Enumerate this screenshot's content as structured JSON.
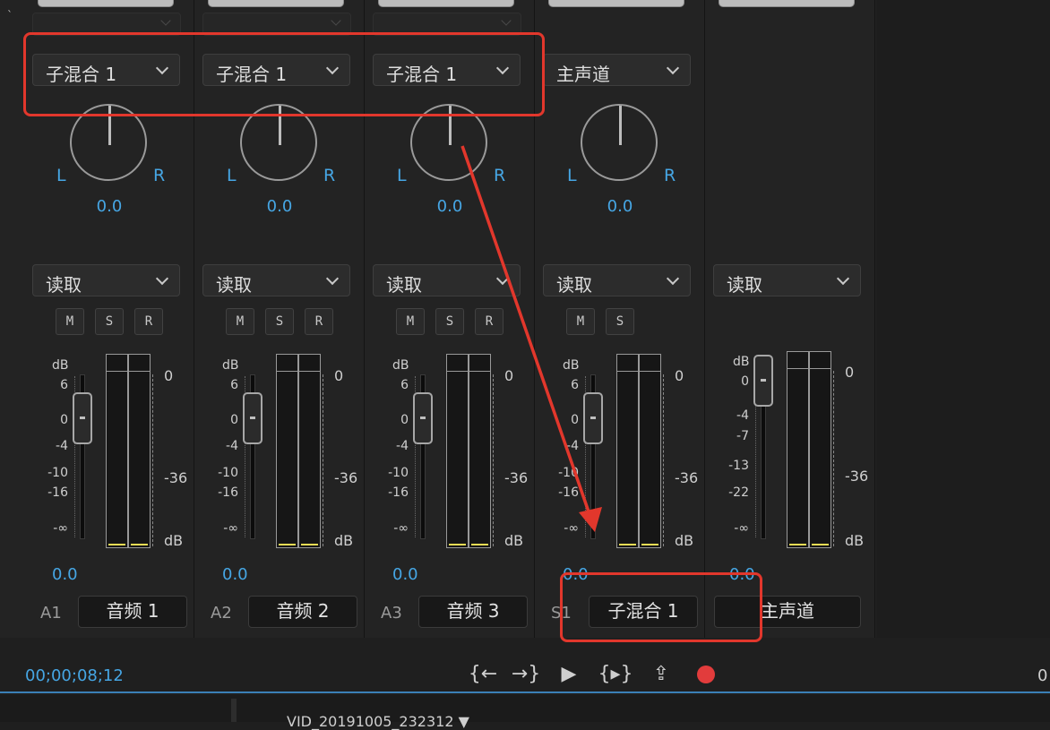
{
  "corner_mark": "`",
  "channels": [
    {
      "id": "A1",
      "output": "子混合 1",
      "pan_l": "L",
      "pan_r": "R",
      "pan_value": "0.0",
      "automation": "读取",
      "buttons": [
        "M",
        "S",
        "R"
      ],
      "scale_header": "dB",
      "scale": [
        "6",
        "0",
        "-4",
        "-10",
        "-16",
        "-∞"
      ],
      "meter_scale": [
        "0",
        "-36",
        "dB"
      ],
      "volume": "0.0",
      "name": "音频 1"
    },
    {
      "id": "A2",
      "output": "子混合 1",
      "pan_l": "L",
      "pan_r": "R",
      "pan_value": "0.0",
      "automation": "读取",
      "buttons": [
        "M",
        "S",
        "R"
      ],
      "scale_header": "dB",
      "scale": [
        "6",
        "0",
        "-4",
        "-10",
        "-16",
        "-∞"
      ],
      "meter_scale": [
        "0",
        "-36",
        "dB"
      ],
      "volume": "0.0",
      "name": "音频 2"
    },
    {
      "id": "A3",
      "output": "子混合 1",
      "pan_l": "L",
      "pan_r": "R",
      "pan_value": "0.0",
      "automation": "读取",
      "buttons": [
        "M",
        "S",
        "R"
      ],
      "scale_header": "dB",
      "scale": [
        "6",
        "0",
        "-4",
        "-10",
        "-16",
        "-∞"
      ],
      "meter_scale": [
        "0",
        "-36",
        "dB"
      ],
      "volume": "0.0",
      "name": "音频 3"
    },
    {
      "id": "S1",
      "output": "主声道",
      "pan_l": "L",
      "pan_r": "R",
      "pan_value": "0.0",
      "automation": "读取",
      "buttons": [
        "M",
        "S"
      ],
      "scale_header": "dB",
      "scale": [
        "6",
        "0",
        "-4",
        "-10",
        "-16",
        "-∞"
      ],
      "meter_scale": [
        "0",
        "-36",
        "dB"
      ],
      "volume": "0.0",
      "name": "子混合 1"
    }
  ],
  "master": {
    "automation": "读取",
    "scale_header": "dB",
    "scale": [
      "0",
      "-4",
      "-7",
      "-13",
      "-22",
      "-∞"
    ],
    "meter_scale": [
      "0",
      "-36",
      "dB"
    ],
    "volume": "0.0",
    "name": "主声道"
  },
  "transport": {
    "timecode": "00;00;08;12",
    "step_back": "{←",
    "step_forward": "→}",
    "play": "▶",
    "loop": "{▸}",
    "export": "⇪",
    "record_color": "#e23c3c",
    "right_edge": "0"
  },
  "timeline": {
    "clip_name": "VID_20191005_232312 ▼"
  },
  "colors": {
    "accent_blue": "#46a6e4",
    "annotation_red": "#e2372c",
    "meter_yellow": "#e9dc55"
  }
}
